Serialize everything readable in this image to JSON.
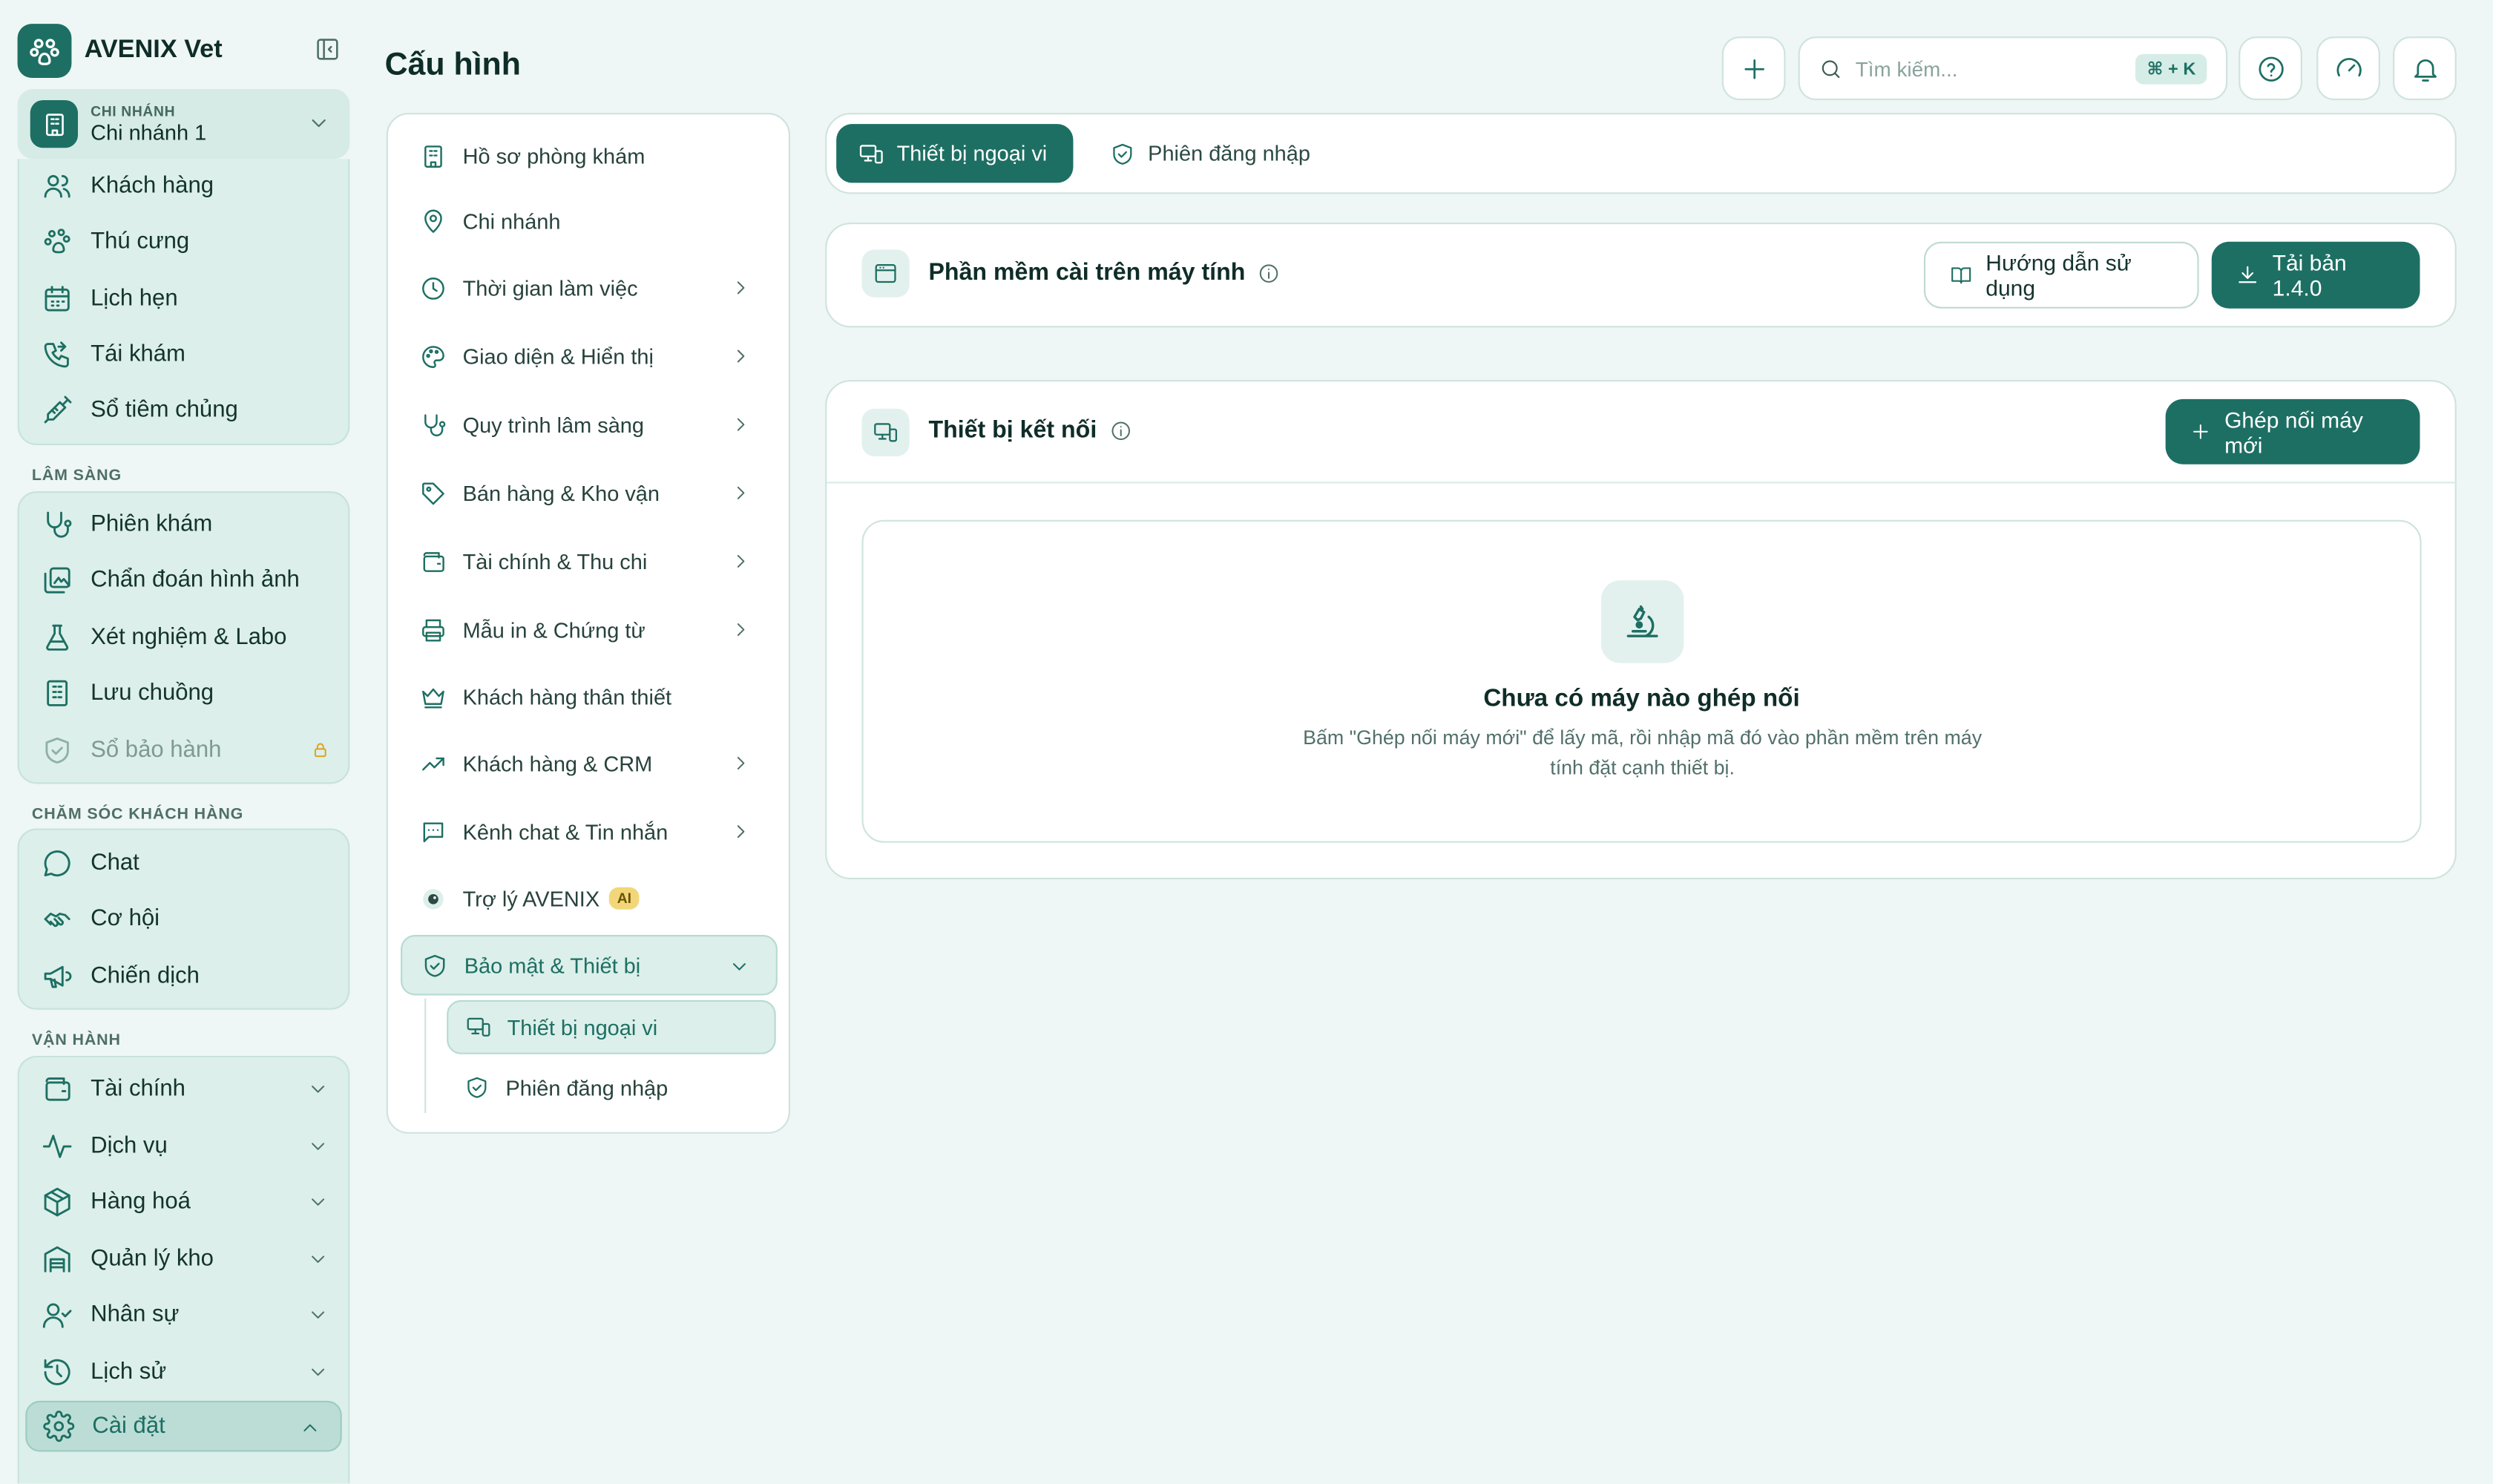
{
  "brand": {
    "name": "AVENIX Vet"
  },
  "branch": {
    "caption": "CHI NHÁNH",
    "value": "Chi nhánh 1"
  },
  "sidebar": {
    "group1": [
      {
        "label": "Khách hàng",
        "icon": "users-icon"
      },
      {
        "label": "Thú cưng",
        "icon": "paw-icon"
      },
      {
        "label": "Lịch hẹn",
        "icon": "calendar-icon"
      },
      {
        "label": "Tái khám",
        "icon": "phone-icon"
      },
      {
        "label": "Sổ tiêm chủng",
        "icon": "syringe-icon"
      }
    ],
    "section_clinical": "LÂM SÀNG",
    "clinical": [
      {
        "label": "Phiên khám",
        "icon": "stethoscope-icon"
      },
      {
        "label": "Chẩn đoán hình ảnh",
        "icon": "image-icon"
      },
      {
        "label": "Xét nghiệm & Labo",
        "icon": "flask-icon"
      },
      {
        "label": "Lưu chuồng",
        "icon": "building-icon"
      },
      {
        "label": "Sổ bảo hành",
        "icon": "shield-icon",
        "locked": true
      }
    ],
    "section_care": "CHĂM SÓC KHÁCH HÀNG",
    "care": [
      {
        "label": "Chat",
        "icon": "chat-icon"
      },
      {
        "label": "Cơ hội",
        "icon": "handshake-icon"
      },
      {
        "label": "Chiến dịch",
        "icon": "megaphone-icon"
      }
    ],
    "section_ops": "VẬN HÀNH",
    "ops": [
      {
        "label": "Tài chính",
        "icon": "wallet-icon"
      },
      {
        "label": "Dịch vụ",
        "icon": "activity-icon"
      },
      {
        "label": "Hàng hoá",
        "icon": "box-icon"
      },
      {
        "label": "Quản lý kho",
        "icon": "warehouse-icon"
      },
      {
        "label": "Nhân sự",
        "icon": "user-check-icon"
      },
      {
        "label": "Lịch sử",
        "icon": "history-icon"
      }
    ],
    "settings_label": "Cài đặt"
  },
  "header": {
    "title": "Cấu hình",
    "search_placeholder": "Tìm kiếm...",
    "shortcut": "⌘ + K"
  },
  "settings_menu": {
    "items": [
      {
        "label": "Hồ sơ phòng khám",
        "has_chevron": false
      },
      {
        "label": "Chi nhánh",
        "has_chevron": false
      },
      {
        "label": "Thời gian làm việc",
        "has_chevron": true
      },
      {
        "label": "Giao diện & Hiển thị",
        "has_chevron": true
      },
      {
        "label": "Quy trình lâm sàng",
        "has_chevron": true
      },
      {
        "label": "Bán hàng & Kho vận",
        "has_chevron": true
      },
      {
        "label": "Tài chính & Thu chi",
        "has_chevron": true
      },
      {
        "label": "Mẫu in & Chứng từ",
        "has_chevron": true
      },
      {
        "label": "Khách hàng thân thiết",
        "has_chevron": false
      },
      {
        "label": "Khách hàng & CRM",
        "has_chevron": true
      },
      {
        "label": "Kênh chat & Tin nhắn",
        "has_chevron": true
      },
      {
        "label": "Trợ lý AVENIX",
        "has_chevron": false,
        "badge": "AI"
      },
      {
        "label": "Bảo mật & Thiết bị",
        "has_chevron": true,
        "open": true
      }
    ],
    "sub_items": [
      {
        "label": "Thiết bị ngoại vi",
        "active": true
      },
      {
        "label": "Phiên đăng nhập",
        "active": false
      }
    ]
  },
  "tabs": [
    {
      "label": "Thiết bị ngoại vi",
      "active": true
    },
    {
      "label": "Phiên đăng nhập",
      "active": false
    }
  ],
  "software_card": {
    "title": "Phần mềm cài trên máy tính",
    "guide_button": "Hướng dẫn sử dụng",
    "download_button": "Tải bản 1.4.0"
  },
  "devices_card": {
    "title": "Thiết bị kết nối",
    "pair_button": "Ghép nối máy mới",
    "empty_title": "Chưa có máy nào ghép nối",
    "empty_desc": "Bấm \"Ghép nối máy mới\" để lấy mã, rồi nhập mã đó vào phần mềm trên máy tính đặt cạnh thiết bị."
  },
  "colors": {
    "accent": "#1d6f63",
    "background": "#eef7f5",
    "ai_badge": "#f2d77a"
  }
}
